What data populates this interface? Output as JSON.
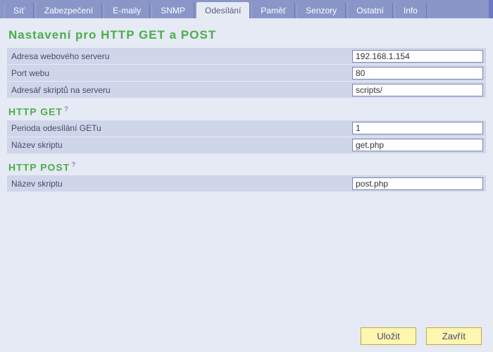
{
  "tabs": [
    {
      "label": "Síť"
    },
    {
      "label": "Zabezpečení"
    },
    {
      "label": "E-maily"
    },
    {
      "label": "SNMP"
    },
    {
      "label": "Odesílání"
    },
    {
      "label": "Paměť"
    },
    {
      "label": "Senzory"
    },
    {
      "label": "Ostatní"
    },
    {
      "label": "Info"
    }
  ],
  "active_tab_index": 4,
  "page_title": "Nastavení pro HTTP GET a POST",
  "sections": {
    "general": {
      "rows": {
        "server_addr": {
          "label": "Adresa webového serveru",
          "value": "192.168.1.154"
        },
        "web_port": {
          "label": "Port webu",
          "value": "80"
        },
        "script_dir": {
          "label": "Adresář skriptů na serveru",
          "value": "scripts/"
        }
      }
    },
    "http_get": {
      "title": "HTTP GET",
      "help": "?",
      "rows": {
        "period": {
          "label": "Perioda odesílání GETu",
          "value": "1"
        },
        "script_name": {
          "label": "Název skriptu",
          "value": "get.php"
        }
      }
    },
    "http_post": {
      "title": "HTTP POST",
      "help": "?",
      "rows": {
        "script_name": {
          "label": "Název skriptu",
          "value": "post.php"
        }
      }
    }
  },
  "buttons": {
    "save": "Uložit",
    "close": "Zavřít"
  }
}
